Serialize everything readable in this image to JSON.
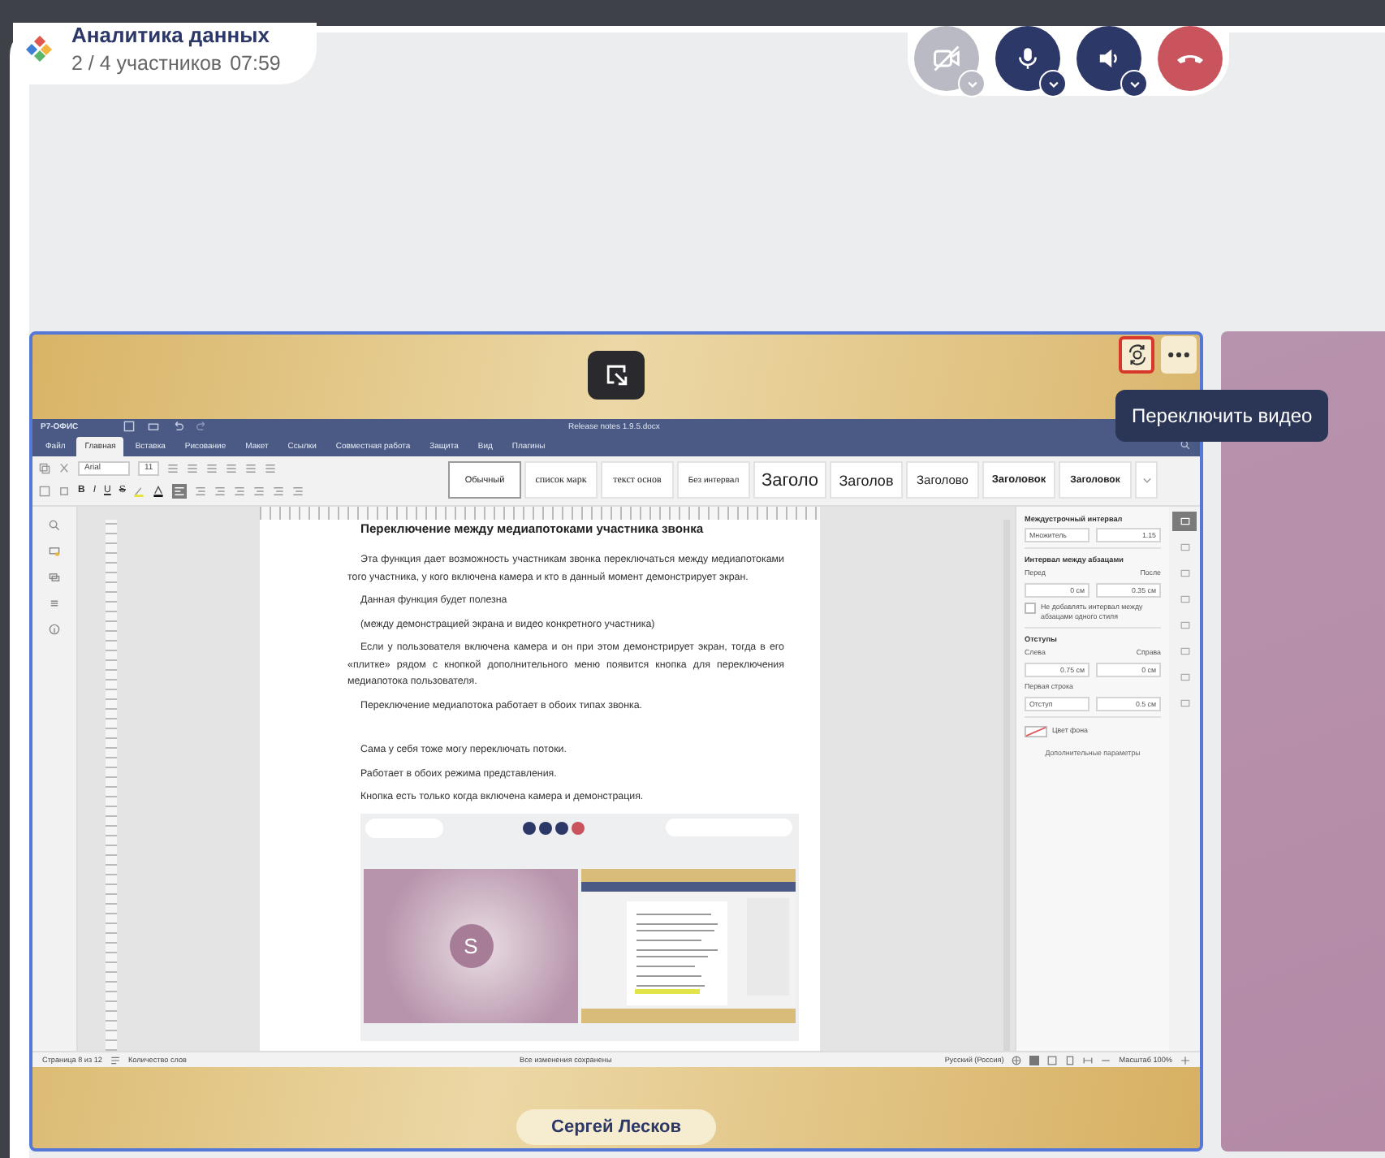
{
  "header": {
    "title": "Аналитика данных",
    "participants": "2 / 4 участников",
    "timer": "07:59"
  },
  "call_controls": [
    {
      "kind": "camera",
      "on": false
    },
    {
      "kind": "microphone",
      "on": true
    },
    {
      "kind": "speaker",
      "on": true
    },
    {
      "kind": "hangup"
    }
  ],
  "main_tile": {
    "switch_video_highlighted": true,
    "tooltip": "Переключить видео",
    "participant_name": "Сергей Лесков",
    "shared_screen": {
      "app_name": "Р7-ОФИС",
      "document_title": "Release notes 1.9.5.docx",
      "menu_tabs": [
        {
          "label": "Файл",
          "selected": false
        },
        {
          "label": "Главная",
          "selected": true
        },
        {
          "label": "Вставка",
          "selected": false
        },
        {
          "label": "Рисование",
          "selected": false
        },
        {
          "label": "Макет",
          "selected": false
        },
        {
          "label": "Ссылки",
          "selected": false
        },
        {
          "label": "Совместная работа",
          "selected": false
        },
        {
          "label": "Защита",
          "selected": false
        },
        {
          "label": "Вид",
          "selected": false
        },
        {
          "label": "Плагины",
          "selected": false
        }
      ],
      "font": "Arial",
      "font_size": "11",
      "format_buttons": [
        "B",
        "I",
        "U",
        "S"
      ],
      "styles": [
        {
          "label": "Обычный",
          "kind": "normal",
          "selected": true
        },
        {
          "label": "список марк",
          "kind": "serif",
          "selected": false
        },
        {
          "label": "текст основ",
          "kind": "serif",
          "selected": false
        },
        {
          "label": "Без интервал",
          "kind": "compact",
          "selected": false
        },
        {
          "label": "Заголо",
          "kind": "h1",
          "selected": false
        },
        {
          "label": "Заголов",
          "kind": "h2",
          "selected": false
        },
        {
          "label": "Заголово",
          "kind": "h3",
          "selected": false
        },
        {
          "label": "Заголовок",
          "kind": "h4",
          "selected": false
        },
        {
          "label": "Заголовок",
          "kind": "h5",
          "selected": false
        }
      ],
      "document": {
        "paragraphs": [
          {
            "kind": "heading",
            "text": "Переключение между медиапотоками участника звонка"
          },
          {
            "kind": "justified",
            "text": "Эта функция дает возможность участникам звонка переключаться между медиапотоками того участника, у кого включена камера и кто в данный момент демонстрирует экран."
          },
          {
            "kind": "plain",
            "text": "Данная функция будет полезна"
          },
          {
            "kind": "plain",
            "text": "(между демонстрацией экрана и видео конкретного участника)"
          },
          {
            "kind": "justified",
            "text": "Если у пользователя включена камера и он при этом демонстрирует экран, тогда в его «плитке» рядом с кнопкой дополнительного меню появится кнопка для переключения медиапотока пользователя."
          },
          {
            "kind": "plain",
            "text": "Переключение медиапотока работает в обоих типах звонка."
          },
          {
            "kind": "spaced",
            "text": "Сама у себя тоже могу переключать потоки."
          },
          {
            "kind": "plain",
            "text": "Работает в обоих режима представления."
          },
          {
            "kind": "plain",
            "text": "Кнопка есть только когда включена камера и демонстрация."
          }
        ],
        "embedded_screenshot": {
          "avatar_letter": "S"
        }
      },
      "paragraph_panel": {
        "line_spacing_label": "Междустрочный интервал",
        "line_spacing_mode": "Множитель",
        "line_spacing_value": "1.15",
        "paragraph_spacing_label": "Интервал между абзацами",
        "before_label": "Перед",
        "after_label": "После",
        "before_value": "0 см",
        "after_value": "0.35 см",
        "no_spacing_option": {
          "label": "Не добавлять интервал между абзацами одного стиля",
          "checked": false
        },
        "indents_label": "Отступы",
        "left_label": "Слева",
        "right_label": "Справа",
        "left_value": "0.75 см",
        "right_value": "0 см",
        "first_line_label": "Первая строка",
        "first_line_mode": "Отступ",
        "first_line_value": "0.5 см",
        "background_label": "Цвет фона",
        "advanced_link": "Дополнительные параметры"
      },
      "side_panel_tabs": [
        {
          "selected": true
        },
        {
          "selected": false
        },
        {
          "selected": false
        },
        {
          "selected": false
        },
        {
          "selected": false
        },
        {
          "selected": false
        },
        {
          "selected": false
        },
        {
          "selected": false
        }
      ],
      "status_bar": {
        "page": "Страница 8 из 12",
        "word_count": "Количество слов",
        "save_state": "Все изменения сохранены",
        "language": "Русский (Россия)",
        "zoom": "Масштаб 100%"
      }
    }
  }
}
